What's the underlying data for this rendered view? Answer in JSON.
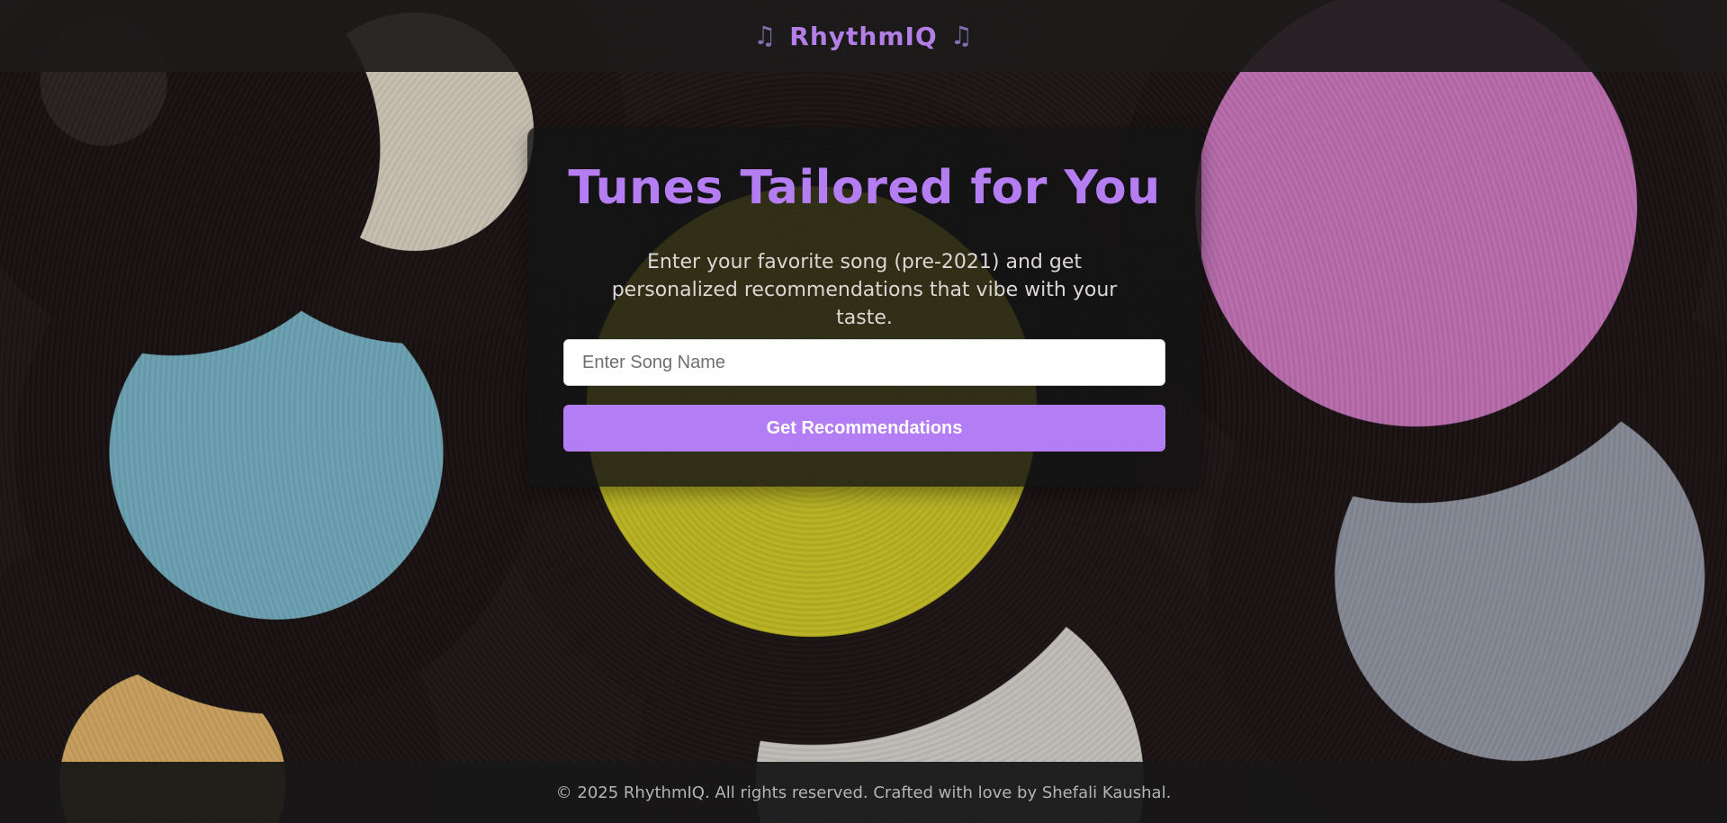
{
  "header": {
    "left_icon": "music-note-icon",
    "brand": "RhythmIQ",
    "right_icon": "music-note-icon",
    "note_glyph": "♫"
  },
  "hero": {
    "title": "Tunes Tailored for You",
    "subtitle": "Enter your favorite song (pre-2021) and get personalized recommendations that vibe with your taste."
  },
  "form": {
    "placeholder": "Enter Song Name",
    "value": "",
    "button_label": "Get Recommendations"
  },
  "footer": {
    "text": "© 2025 RhythmIQ. All rights reserved. Crafted with love by Shefali Kaushal."
  },
  "colors": {
    "accent": "#b27df5",
    "header_bg": "#1c1a1a",
    "card_bg": "#141414",
    "footer_bg": "#181717"
  }
}
